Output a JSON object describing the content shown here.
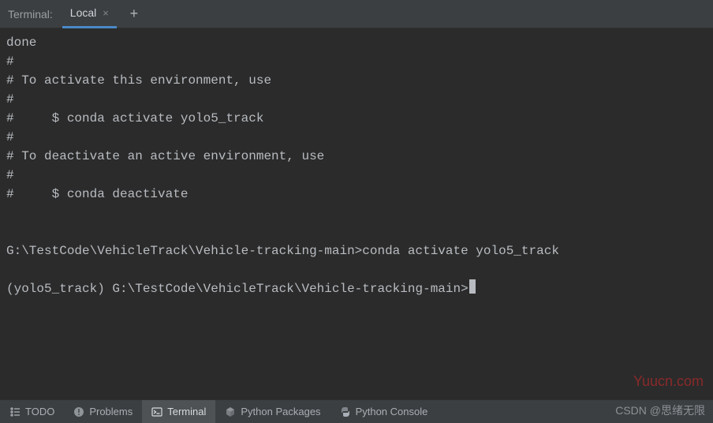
{
  "topbar": {
    "label": "Terminal:",
    "tab_name": "Local",
    "close_glyph": "×",
    "add_glyph": "+"
  },
  "terminal": {
    "lines": [
      "done",
      "#",
      "# To activate this environment, use",
      "#",
      "#     $ conda activate yolo5_track",
      "#",
      "# To deactivate an active environment, use",
      "#",
      "#     $ conda deactivate",
      "",
      "",
      "G:\\TestCode\\VehicleTrack\\Vehicle-tracking-main>conda activate yolo5_track",
      "",
      "(yolo5_track) G:\\TestCode\\VehicleTrack\\Vehicle-tracking-main>"
    ]
  },
  "bottombar": {
    "todo": "TODO",
    "problems": "Problems",
    "terminal": "Terminal",
    "python_packages": "Python Packages",
    "python_console": "Python Console"
  },
  "watermark": {
    "site": "Yuucn.com",
    "csdn": "CSDN @思绪无限"
  }
}
